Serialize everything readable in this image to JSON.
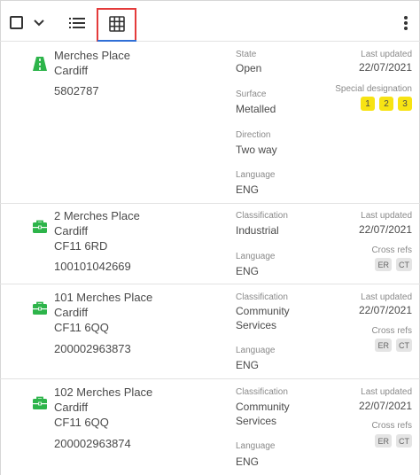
{
  "toolbar": {
    "select_all_icon": "checkbox-icon",
    "dropdown_icon": "chevron-down-icon",
    "list_view_icon": "list-view-icon",
    "grid_view_icon": "grid-view-icon",
    "more_icon": "more-vertical-icon",
    "highlight_color": "#e43b3b",
    "active_color": "#2f6fd6"
  },
  "records": [
    {
      "icon": "street-road-icon",
      "icon_color": "#2db44a",
      "address": [
        "Merches Place",
        "Cardiff"
      ],
      "id": "5802787",
      "fields": [
        {
          "label": "State",
          "value": [
            "Open"
          ]
        },
        {
          "label": "Surface",
          "value": [
            "Metalled"
          ]
        },
        {
          "label": "Direction",
          "value": [
            "Two way"
          ]
        },
        {
          "label": "Language",
          "value": [
            "ENG"
          ]
        }
      ],
      "updated_label": "Last updated",
      "updated_value": "22/07/2021",
      "tags_label": "Special designation",
      "tags": [
        "1",
        "2",
        "3"
      ]
    },
    {
      "icon": "briefcase-icon",
      "icon_color": "#2db44a",
      "address": [
        "2 Merches Place",
        "Cardiff",
        "CF11 6RD"
      ],
      "id": "100101042669",
      "fields": [
        {
          "label": "Classification",
          "value": [
            "Industrial"
          ]
        },
        {
          "label": "Language",
          "value": [
            "ENG"
          ]
        }
      ],
      "updated_label": "Last updated",
      "updated_value": "22/07/2021",
      "tags_label": "Cross refs",
      "tags": [
        "ER",
        "CT"
      ]
    },
    {
      "icon": "briefcase-icon",
      "icon_color": "#2db44a",
      "address": [
        "101 Merches Place",
        "Cardiff",
        "CF11 6QQ"
      ],
      "id": "200002963873",
      "fields": [
        {
          "label": "Classification",
          "value": [
            "Community",
            "Services"
          ]
        },
        {
          "label": "Language",
          "value": [
            "ENG"
          ]
        }
      ],
      "updated_label": "Last updated",
      "updated_value": "22/07/2021",
      "tags_label": "Cross refs",
      "tags": [
        "ER",
        "CT"
      ]
    },
    {
      "icon": "briefcase-icon",
      "icon_color": "#2db44a",
      "address": [
        "102 Merches Place",
        "Cardiff",
        "CF11 6QQ"
      ],
      "id": "200002963874",
      "fields": [
        {
          "label": "Classification",
          "value": [
            "Community",
            "Services"
          ]
        },
        {
          "label": "Language",
          "value": [
            "ENG"
          ]
        }
      ],
      "updated_label": "Last updated",
      "updated_value": "22/07/2021",
      "tags_label": "Cross refs",
      "tags": [
        "ER",
        "CT"
      ]
    }
  ]
}
